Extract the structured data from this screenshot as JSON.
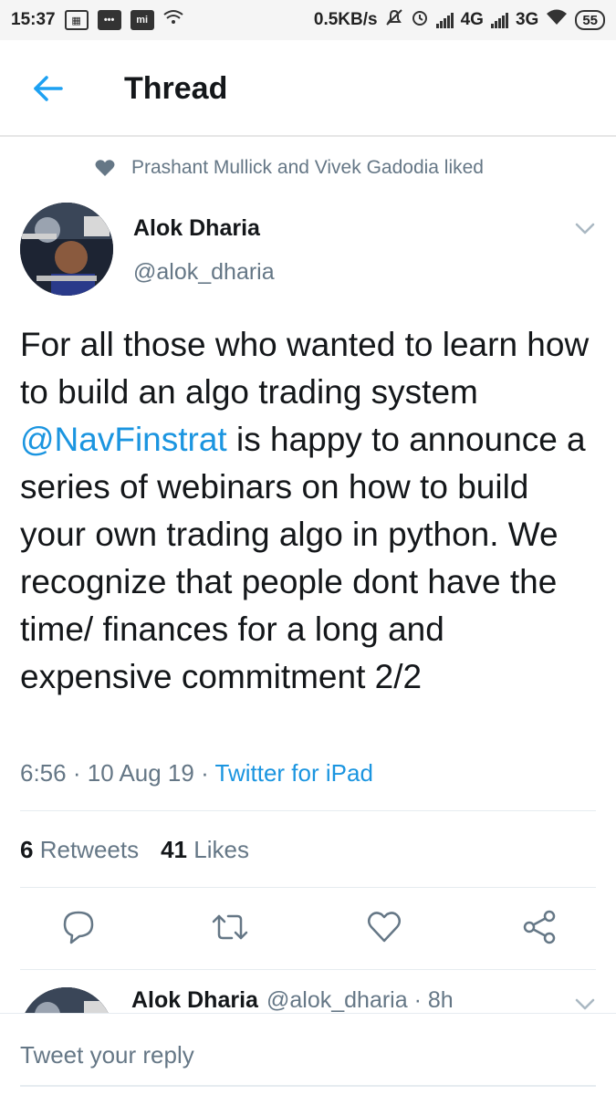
{
  "statusbar": {
    "time": "15:37",
    "mi_label": "mi",
    "net_speed": "0.5KB/s",
    "net_4g": "4G",
    "net_3g": "3G",
    "battery": "55"
  },
  "appbar": {
    "title": "Thread",
    "back_icon": "arrow-left-icon"
  },
  "social_context": {
    "text": "Prashant Mullick and Vivek Gadodia liked",
    "icon": "heart-icon"
  },
  "tweet": {
    "author_name": "Alok Dharia",
    "author_handle": "@alok_dharia",
    "text_before": "For all those who wanted to learn how to build an algo trading system ",
    "mention": "@NavFinstrat",
    "text_after": " is happy to announce a series of webinars on how to build your own trading algo in python. We recognize that people dont have the time/ finances for a long and expensive commitment 2/2",
    "time": "6:56",
    "date": "10 Aug 19",
    "client": "Twitter for iPad",
    "retweets_count": "6",
    "retweets_label": "Retweets",
    "likes_count": "41",
    "likes_label": "Likes"
  },
  "actions": {
    "reply_icon": "reply-icon",
    "retweet_icon": "retweet-icon",
    "like_icon": "heart-outline-icon",
    "share_icon": "share-icon"
  },
  "next_tweet": {
    "author_name": "Alok Dharia",
    "author_handle": "@alok_dharia",
    "age": "8h"
  },
  "reply": {
    "placeholder": "Tweet your reply"
  },
  "colors": {
    "accent": "#1b95e0",
    "secondary_text": "#657786",
    "primary_text": "#14171a"
  }
}
